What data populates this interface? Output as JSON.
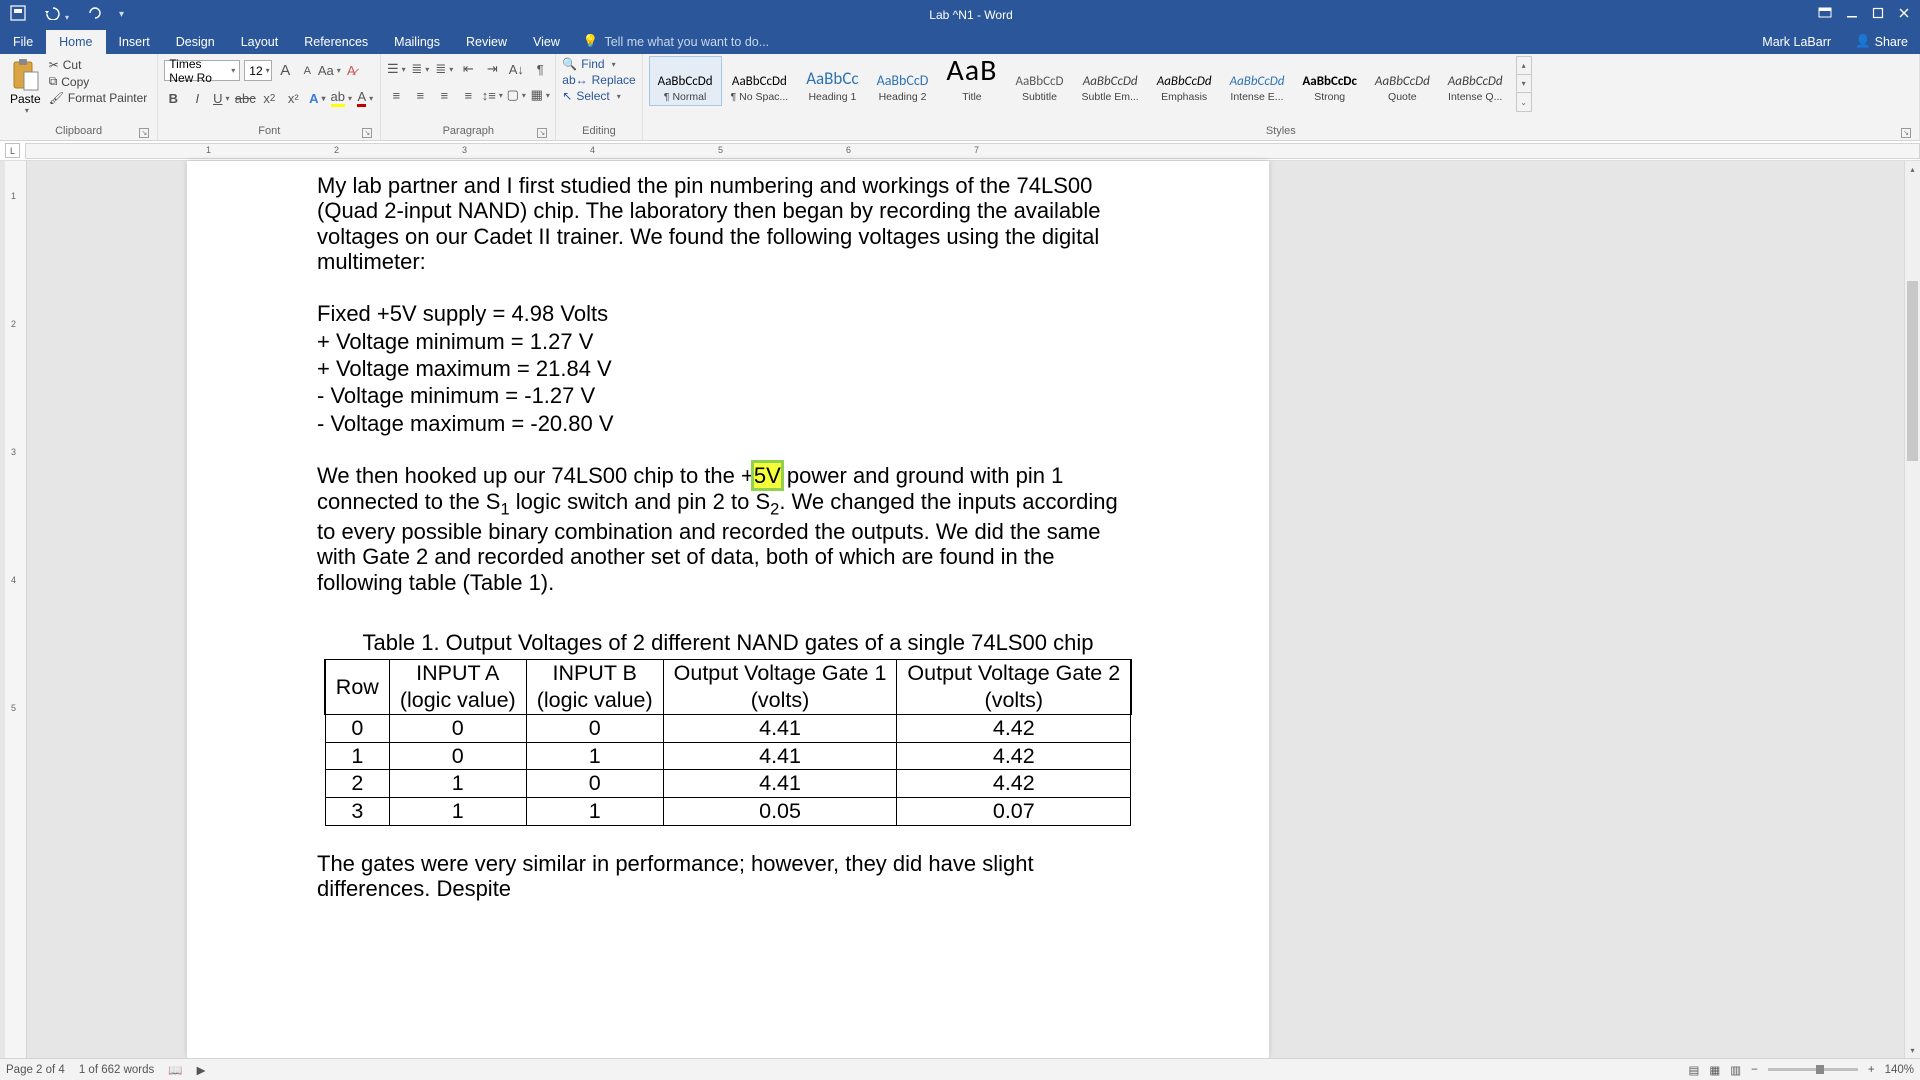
{
  "titlebar": {
    "title": "Lab ^N1 - Word"
  },
  "tabs": [
    "File",
    "Home",
    "Insert",
    "Design",
    "Layout",
    "References",
    "Mailings",
    "Review",
    "View"
  ],
  "tellme": "Tell me what you want to do...",
  "author": "Mark LaBarr",
  "share": "Share",
  "ribbon": {
    "clipboard": {
      "paste": "Paste",
      "cut": "Cut",
      "copy": "Copy",
      "fmt": "Format Painter",
      "label": "Clipboard"
    },
    "font": {
      "name": "Times New Ro",
      "size": "12",
      "label": "Font"
    },
    "paragraph": {
      "label": "Paragraph"
    },
    "editing": {
      "find": "Find",
      "replace": "Replace",
      "select": "Select",
      "label": "Editing"
    },
    "styles": {
      "label": "Styles",
      "items": [
        {
          "name": "¶ Normal",
          "cls": "prev-normal",
          "sel": true
        },
        {
          "name": "¶ No Spac...",
          "cls": "prev-nospace"
        },
        {
          "name": "Heading 1",
          "cls": "prev-h1"
        },
        {
          "name": "Heading 2",
          "cls": "prev-h2"
        },
        {
          "name": "Title",
          "cls": "prev-title"
        },
        {
          "name": "Subtitle",
          "cls": "prev-subtitle"
        },
        {
          "name": "Subtle Em...",
          "cls": "prev-subtle"
        },
        {
          "name": "Emphasis",
          "cls": "prev-emph"
        },
        {
          "name": "Intense E...",
          "cls": "prev-iemph"
        },
        {
          "name": "Strong",
          "cls": "prev-strong"
        },
        {
          "name": "Quote",
          "cls": "prev-quote"
        },
        {
          "name": "Intense Q...",
          "cls": "prev-iquote"
        }
      ]
    }
  },
  "ruler_h": [
    "1",
    "2",
    "3",
    "4",
    "5",
    "6",
    "7"
  ],
  "ruler_v": [
    "1",
    "2",
    "3",
    "4",
    "5"
  ],
  "doc": {
    "p1": "My lab partner and I first studied the pin numbering and workings of the 74LS00 (Quad 2-input NAND) chip. The laboratory then began by recording the available voltages on our Cadet II trainer. We found the following voltages using the digital multimeter:",
    "l1": "Fixed +5V supply = 4.98 Volts",
    "l2": "+ Voltage minimum = 1.27 V",
    "l3": "+ Voltage maximum = 21.84 V",
    "l4": "- Voltage minimum = -1.27 V",
    "l5": "- Voltage maximum = -20.80 V",
    "p2a": "We then hooked up our 74LS00 chip to the +",
    "p2hv": "5V",
    "p2b": " power and ground with pin 1 connected to the S",
    "p2c": " logic switch and pin 2 to S",
    "p2d": ". We changed the inputs according to every possible binary combination and recorded the outputs. We did the same with Gate 2 and recorded another set of data, both of which are found in the following table (Table 1).",
    "tblTitle": "Table 1. Output Voltages of 2 different NAND gates of a single 74LS00 chip",
    "th": {
      "row": "Row",
      "ia": "INPUT A",
      "ia2": "(logic value)",
      "ib": "INPUT B",
      "ib2": "(logic value)",
      "g1": "Output Voltage Gate 1",
      "g1b": "(volts)",
      "g2": "Output Voltage Gate 2",
      "g2b": "(volts)"
    },
    "rows": [
      {
        "r": "0",
        "a": "0",
        "b": "0",
        "g1": "4.41",
        "g2": "4.42"
      },
      {
        "r": "1",
        "a": "0",
        "b": "1",
        "g1": "4.41",
        "g2": "4.42"
      },
      {
        "r": "2",
        "a": "1",
        "b": "0",
        "g1": "4.41",
        "g2": "4.42"
      },
      {
        "r": "3",
        "a": "1",
        "b": "1",
        "g1": "0.05",
        "g2": "0.07"
      }
    ],
    "p3": "The gates were very similar in performance; however, they did have slight differences. Despite"
  },
  "status": {
    "page": "Page 2 of 4",
    "words": "1 of 662 words",
    "zoom": "140%"
  }
}
